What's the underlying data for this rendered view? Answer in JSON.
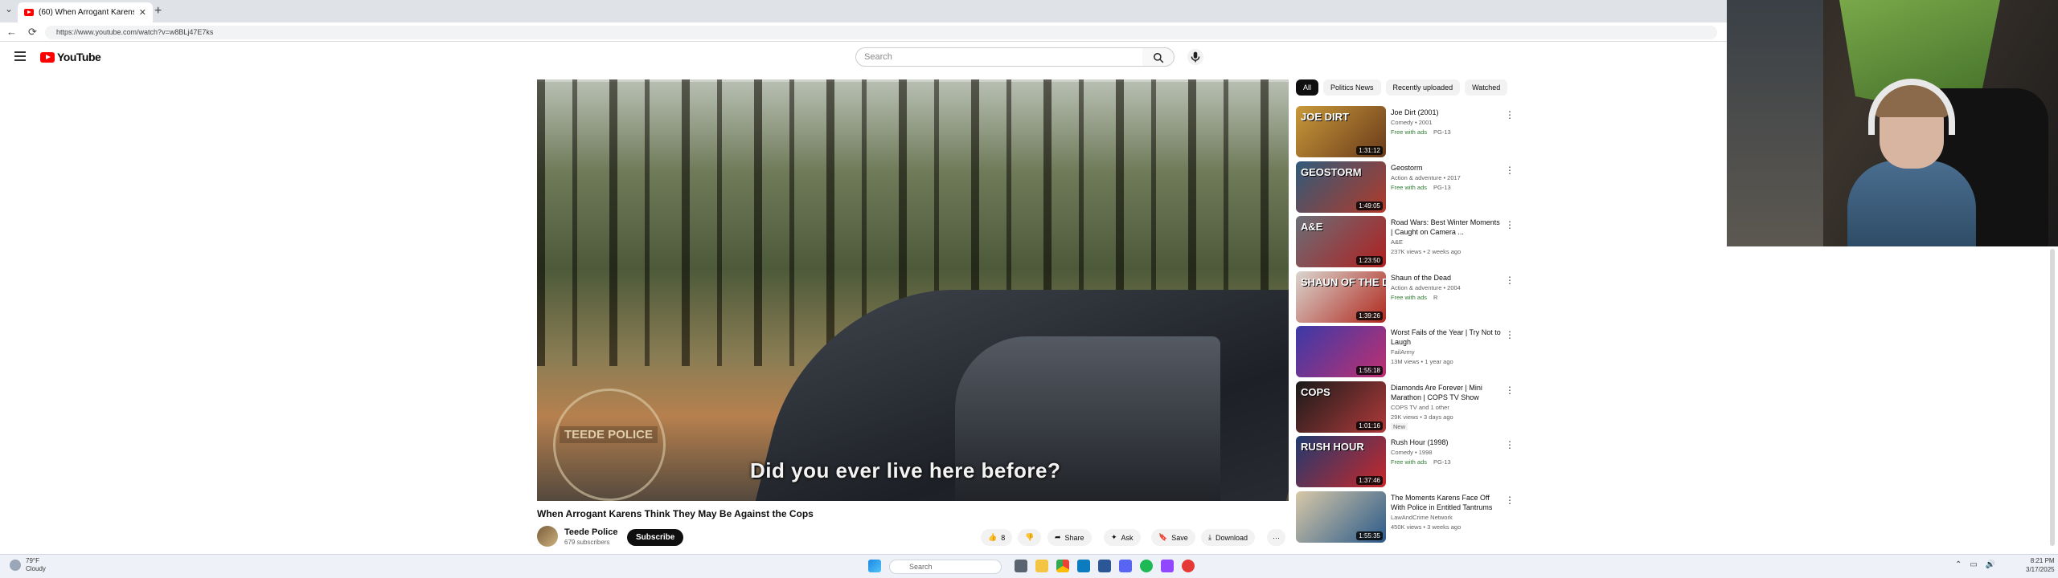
{
  "browser": {
    "tab_title": "(60) When Arrogant Karens",
    "new_tab": "+",
    "address": "https://www.youtube.com/watch?v=w8BLj47E7ks"
  },
  "header": {
    "logo_text": "YouTube",
    "search_placeholder": "Search"
  },
  "video": {
    "caption": "Did you ever live here before?",
    "watermark": "TEEDE POLICE",
    "title": "When Arrogant Karens Think They May Be Against the Cops",
    "channel": "Teede Police",
    "subscribers": "679 subscribers",
    "subscribe_label": "Subscribe",
    "like_count": "8",
    "share_label": "Share",
    "ask_label": "Ask",
    "save_label": "Save",
    "download_label": "Download",
    "more_label": "···"
  },
  "chips": [
    "All",
    "Politics News",
    "Recently uploaded",
    "Watched"
  ],
  "recommendations": [
    {
      "title": "Joe Dirt (2001)",
      "meta": "Comedy • 2001",
      "badge": "Free with ads",
      "rating": "PG-13",
      "duration": "1:31:12",
      "thumb_text": "JOE DIRT",
      "color1": "#c89a3a",
      "color2": "#6a3a1a"
    },
    {
      "title": "Geostorm",
      "meta": "Action & adventure • 2017",
      "badge": "Free with ads",
      "rating": "PG-13",
      "duration": "1:49:05",
      "thumb_text": "GEOSTORM",
      "color1": "#2f5a7a",
      "color2": "#b23a2a"
    },
    {
      "title": "Road Wars: Best Winter Moments | Caught on Camera ...",
      "meta": "A&E",
      "meta2": "237K views • 2 weeks ago",
      "duration": "1:23:50",
      "thumb_text": "A&E",
      "color1": "#6a6f78",
      "color2": "#b02020"
    },
    {
      "title": "Shaun of the Dead",
      "meta": "Action & adventure • 2004",
      "badge": "Free with ads",
      "rating": "R",
      "duration": "1:39:26",
      "thumb_text": "SHAUN OF THE DEAD",
      "color1": "#d9d6cf",
      "color2": "#b0281e"
    },
    {
      "title": "Worst Fails of the Year | Try Not to Laugh",
      "meta": "FailArmy",
      "meta2": "13M views • 1 year ago",
      "duration": "1:55:18",
      "thumb_text": "",
      "color1": "#3a3aa8",
      "color2": "#c03070"
    },
    {
      "title": "Diamonds Are Forever | Mini Marathon | COPS TV Show",
      "meta": "COPS TV and 1 other",
      "meta2": "29K views • 3 days ago",
      "meta3": "New",
      "duration": "1:01:16",
      "thumb_text": "COPS",
      "color1": "#1a1a1a",
      "color2": "#b03a3a"
    },
    {
      "title": "Rush Hour (1998)",
      "meta": "Comedy • 1998",
      "badge": "Free with ads",
      "rating": "PG-13",
      "duration": "1:37:46",
      "thumb_text": "RUSH HOUR",
      "color1": "#1f3a70",
      "color2": "#c8282a"
    },
    {
      "title": "The Moments Karens Face Off With Police in Entitled Tantrums",
      "meta": "LawAndCrime Network",
      "meta2": "450K views • 3 weeks ago",
      "duration": "1:55:35",
      "thumb_text": "",
      "color1": "#d8c8a8",
      "color2": "#2a5a8a"
    }
  ],
  "taskbar": {
    "weather_temp": "79°F",
    "weather_desc": "Cloudy",
    "search_placeholder": "Search",
    "time": "8:21 PM",
    "date": "3/17/2025"
  }
}
